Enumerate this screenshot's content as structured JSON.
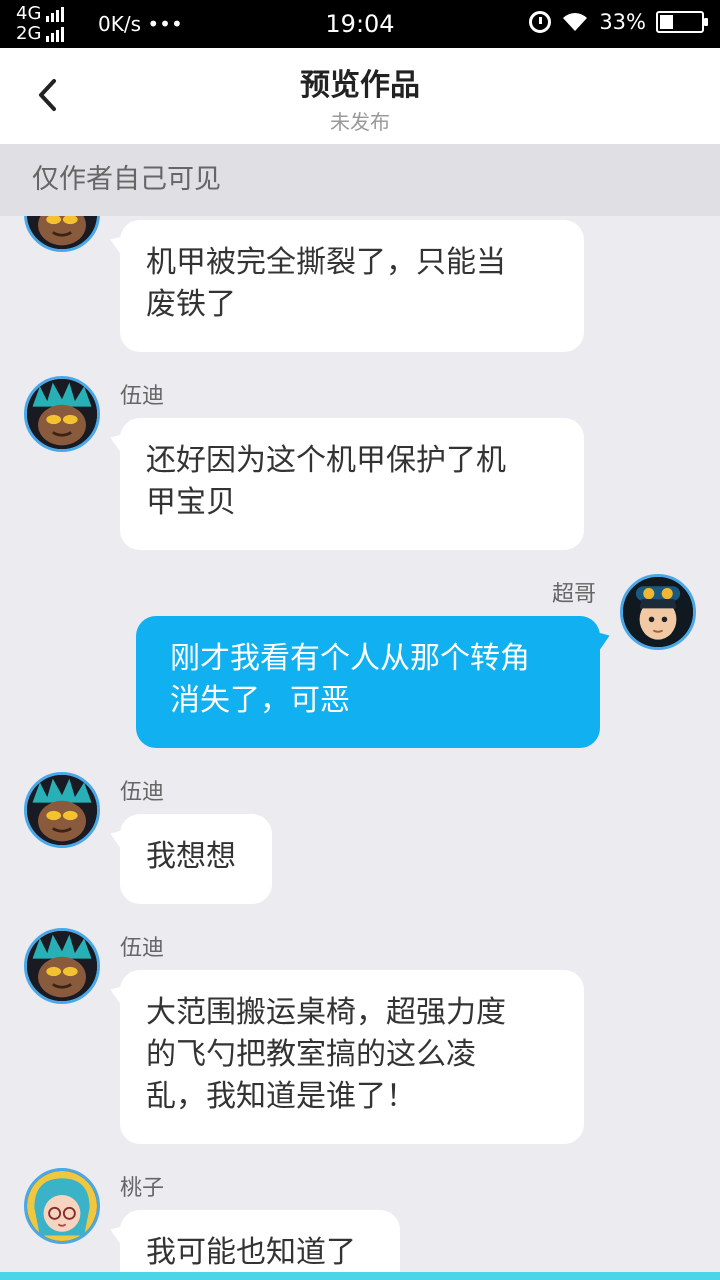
{
  "status_bar": {
    "net_top": "4G",
    "net_bottom": "2G",
    "speed": "0K/s •••",
    "time": "19:04",
    "battery_percent": "33%",
    "battery_level": 0.33
  },
  "header": {
    "back_icon": "chevron-left-icon",
    "title": "预览作品",
    "subtitle": "未发布"
  },
  "notice": "仅作者自己可见",
  "messages": [
    {
      "sender": "",
      "side": "left",
      "avatar": "wudi-avatar",
      "text_lines": [
        "机甲被完全撕裂了，只能当",
        "废铁了"
      ]
    },
    {
      "sender": "伍迪",
      "side": "left",
      "avatar": "wudi-avatar",
      "text_lines": [
        "还好因为这个机甲保护了机",
        "甲宝贝"
      ]
    },
    {
      "sender": "超哥",
      "side": "right",
      "avatar": "chaoge-avatar",
      "text_lines": [
        "刚才我看有个人从那个转角",
        "消失了，可恶"
      ]
    },
    {
      "sender": "伍迪",
      "side": "left",
      "avatar": "wudi-avatar",
      "text_lines": [
        "我想想"
      ]
    },
    {
      "sender": "伍迪",
      "side": "left",
      "avatar": "wudi-avatar",
      "text_lines": [
        "大范围搬运桌椅，超强力度",
        "的飞勺把教室搞的这么凌",
        "乱，我知道是谁了！"
      ]
    },
    {
      "sender": "桃子",
      "side": "left",
      "avatar": "taozi-avatar",
      "text_lines": [
        "我可能也知道了"
      ]
    }
  ],
  "colors": {
    "accent": "#11b0f0",
    "avatar_border": "#4aa8e8",
    "chat_bg": "#ececf0",
    "bottom_bar": "#4ad6e6"
  }
}
